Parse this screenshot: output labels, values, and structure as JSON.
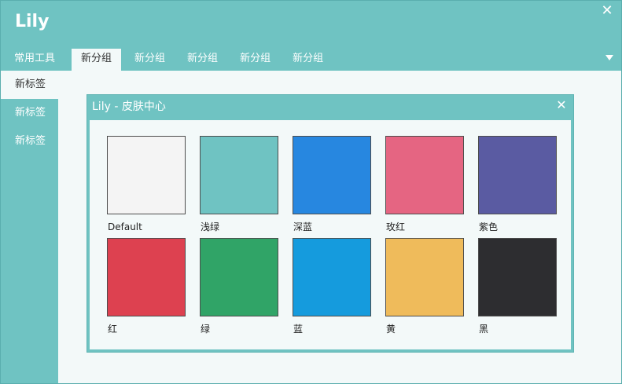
{
  "app": {
    "title": "Lily",
    "close_glyph": "✕"
  },
  "tabs": [
    {
      "label": "常用工具",
      "active": false
    },
    {
      "label": "新分组",
      "active": true
    },
    {
      "label": "新分组",
      "active": false
    },
    {
      "label": "新分组",
      "active": false
    },
    {
      "label": "新分组",
      "active": false
    },
    {
      "label": "新分组",
      "active": false
    }
  ],
  "sidebar": {
    "items": [
      {
        "label": "新标签",
        "active": true
      },
      {
        "label": "新标签",
        "active": false
      },
      {
        "label": "新标签",
        "active": false
      }
    ]
  },
  "dialog": {
    "title": "Lily - 皮肤中心",
    "close_glyph": "✕",
    "skins": [
      {
        "label": "Default",
        "color": "#f4f4f4"
      },
      {
        "label": "浅绿",
        "color": "#6fc3c2"
      },
      {
        "label": "深蓝",
        "color": "#2787e0"
      },
      {
        "label": "玫红",
        "color": "#e56582"
      },
      {
        "label": "紫色",
        "color": "#5a5ba2"
      },
      {
        "label": "红",
        "color": "#dd4150"
      },
      {
        "label": "绿",
        "color": "#30a467"
      },
      {
        "label": "蓝",
        "color": "#159bdd"
      },
      {
        "label": "黄",
        "color": "#efbb5b"
      },
      {
        "label": "黑",
        "color": "#2d2d30"
      }
    ]
  },
  "colors": {
    "accent": "#6fc3c2",
    "panel_bg": "#f3f9f9"
  }
}
